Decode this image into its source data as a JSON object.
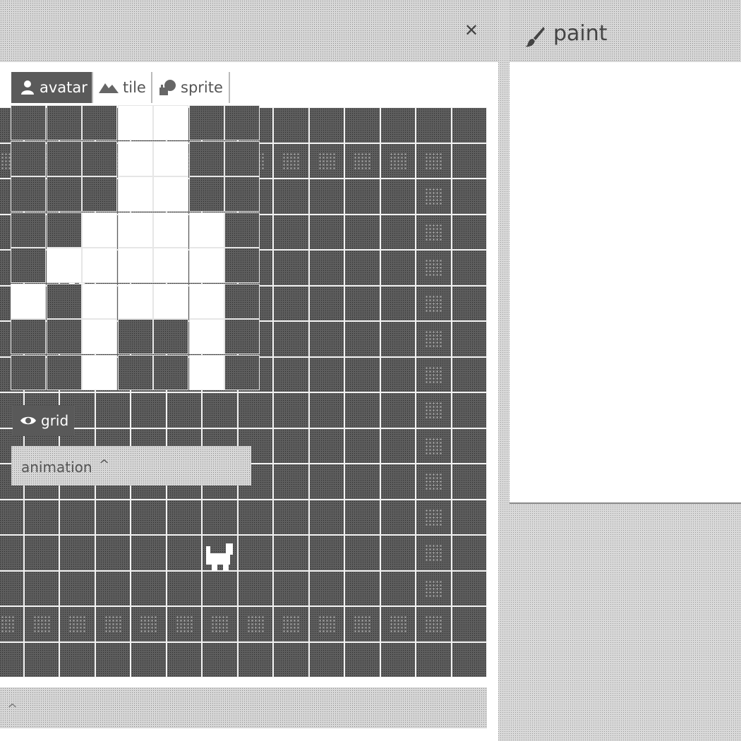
{
  "room": {
    "close_icon": "close-icon",
    "footer_icon": "chevron-up-icon"
  },
  "paint": {
    "title": "paint",
    "title_icon": "brush-icon",
    "tabs": [
      {
        "label": "avatar",
        "icon": "person-icon",
        "active": true
      },
      {
        "label": "tile",
        "icon": "mountain-icon",
        "active": false
      },
      {
        "label": "sprite",
        "icon": "cat-icon",
        "active": false
      }
    ],
    "grid_label": "grid",
    "grid_icon": "eye-icon",
    "animation_label": "animation",
    "animation_icon": "chevron-up-icon"
  },
  "colors": {
    "background": "#5e5e5e",
    "foreground": "#ffffff",
    "tab_active": "#5a5a5a"
  }
}
